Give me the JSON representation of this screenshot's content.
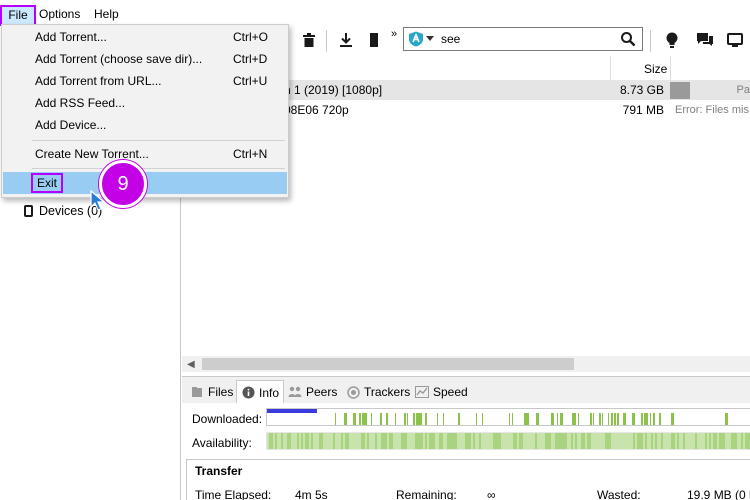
{
  "menubar": {
    "items": [
      {
        "label": "File"
      },
      {
        "label": "Options"
      },
      {
        "label": "Help"
      }
    ]
  },
  "file_menu": {
    "items": [
      {
        "label": "Add Torrent...",
        "shortcut": "Ctrl+O"
      },
      {
        "label": "Add Torrent (choose save dir)...",
        "shortcut": "Ctrl+D"
      },
      {
        "label": "Add Torrent from URL...",
        "shortcut": "Ctrl+U"
      },
      {
        "label": "Add RSS Feed...",
        "shortcut": ""
      },
      {
        "label": "Add Device...",
        "shortcut": ""
      },
      {
        "label": "Create New Torrent...",
        "shortcut": "Ctrl+N"
      },
      {
        "label": "Exit",
        "shortcut": ""
      }
    ]
  },
  "step_marker": {
    "number": "9",
    "color": "#c300e6"
  },
  "search": {
    "value": "see"
  },
  "sidebar": {
    "devices_label": "Devices (0)"
  },
  "torrent_list": {
    "columns": {
      "size": "Size"
    },
    "rows": [
      {
        "name": "n 1 (2019) [1080p]",
        "size": "8.73 GB",
        "status": "Pa"
      },
      {
        "name": "08E06 720p",
        "size": "791 MB",
        "status": "Error: Files mis"
      }
    ]
  },
  "details": {
    "tabs": [
      {
        "label": "Files"
      },
      {
        "label": "Info"
      },
      {
        "label": "Peers"
      },
      {
        "label": "Trackers"
      },
      {
        "label": "Speed"
      }
    ],
    "downloaded_label": "Downloaded:",
    "availability_label": "Availability:",
    "transfer_title": "Transfer",
    "time_elapsed_label": "Time Elapsed:",
    "time_elapsed_value": "4m 5s",
    "remaining_label": "Remaining:",
    "remaining_value": "∞",
    "wasted_label": "Wasted:",
    "wasted_value": "19.9 MB (0 h"
  },
  "colors": {
    "highlight": "#b300ff",
    "menu_selected": "#99ccf3",
    "piece_done": "#8bc34a"
  }
}
